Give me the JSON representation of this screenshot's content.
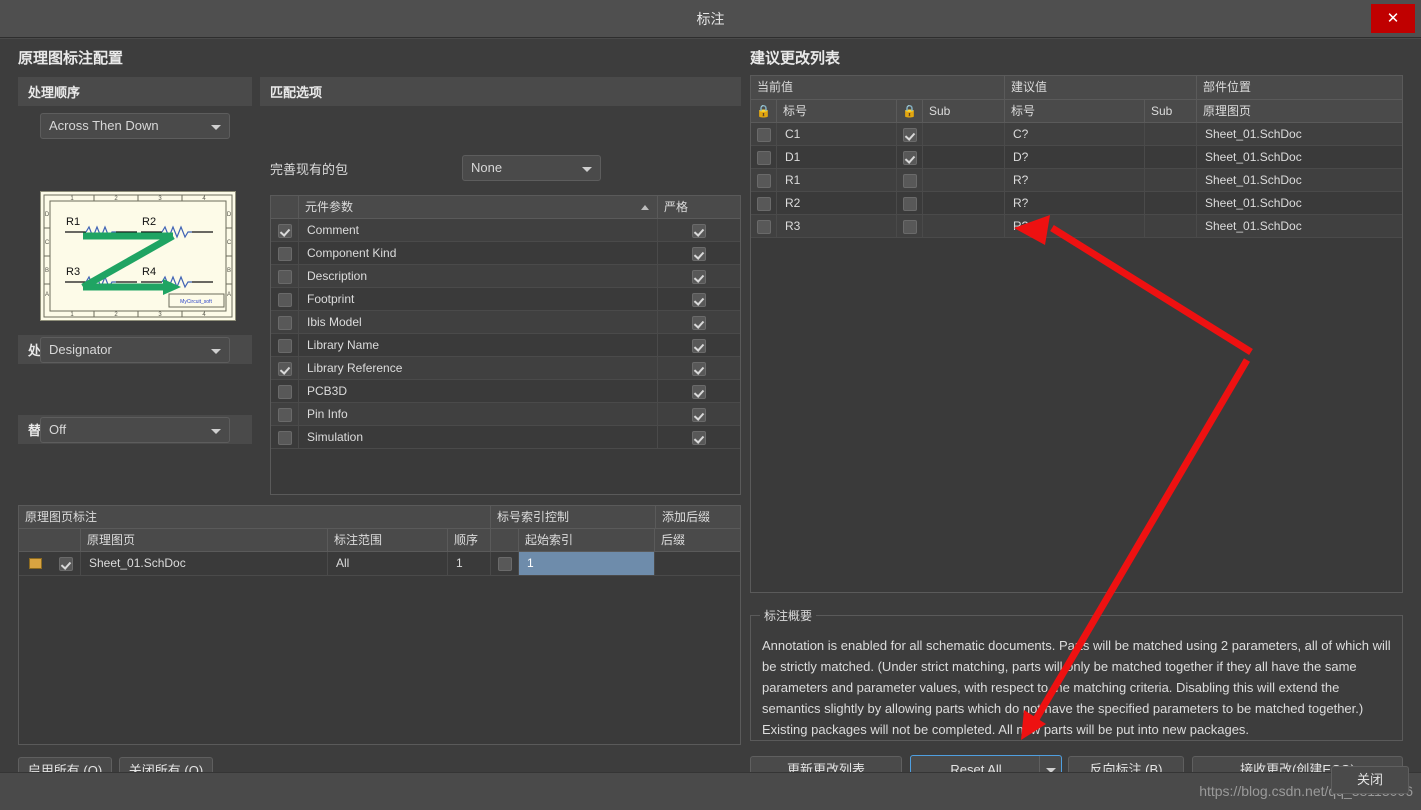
{
  "window": {
    "title": "标注",
    "close_icon": "close-icon"
  },
  "left": {
    "config_title": "原理图标注配置",
    "order_group": {
      "header": "处理顺序",
      "value": "Across Then Down"
    },
    "preview": {
      "designators": [
        "R1",
        "R2",
        "R3",
        "R4"
      ],
      "top_ticks": [
        "1",
        "2",
        "3",
        "4"
      ],
      "bottom_ticks": [
        "1",
        "2",
        "3",
        "4"
      ],
      "left_ticks": [
        "D",
        "C",
        "B",
        "A"
      ],
      "right_ticks": [
        "D",
        "C",
        "B",
        "A"
      ],
      "sheet_label": "MyCircuit_soft"
    },
    "location_group": {
      "header": "处理位置",
      "value": "Designator"
    },
    "subpart_group": {
      "header": "替换子部件",
      "value": "Off"
    },
    "match_group": {
      "header": "匹配选项",
      "refine_label": "完善现有的包",
      "refine_value": "None",
      "columns": [
        "元件参数",
        "严格"
      ],
      "sort_icon": "sort-asc-icon",
      "rows": [
        {
          "checked": true,
          "name": "Comment",
          "strict": true
        },
        {
          "checked": false,
          "name": "Component Kind",
          "strict": true
        },
        {
          "checked": false,
          "name": "Description",
          "strict": true
        },
        {
          "checked": false,
          "name": "Footprint",
          "strict": true
        },
        {
          "checked": false,
          "name": "Ibis Model",
          "strict": true
        },
        {
          "checked": false,
          "name": "Library Name",
          "strict": true
        },
        {
          "checked": true,
          "name": "Library Reference",
          "strict": true
        },
        {
          "checked": false,
          "name": "PCB3D",
          "strict": true
        },
        {
          "checked": false,
          "name": "Pin Info",
          "strict": true
        },
        {
          "checked": false,
          "name": "Simulation",
          "strict": true
        }
      ]
    },
    "sheet_grid": {
      "group_headers": [
        "原理图页标注",
        "标号索引控制",
        "添加后缀"
      ],
      "columns": [
        "原理图页",
        "标注范围",
        "顺序",
        "起始索引",
        "后缀"
      ],
      "rows": [
        {
          "doc_icon": "document-icon",
          "enabled": true,
          "sheet": "Sheet_01.SchDoc",
          "scope": "All",
          "order": "1",
          "index_lock": false,
          "start_index": "1",
          "suffix": ""
        }
      ]
    },
    "buttons": {
      "enable_all": "启用所有 (O)",
      "disable_all": "关闭所有 (O)"
    }
  },
  "right": {
    "changes_title": "建议更改列表",
    "group_headers": [
      "当前值",
      "建议值",
      "部件位置"
    ],
    "columns": {
      "cur_lock": "lock-icon",
      "cur_designator": "标号",
      "prop_lock": "lock-icon",
      "cur_sub": "Sub",
      "prop_designator": "标号",
      "prop_sub": "Sub",
      "location": "原理图页"
    },
    "rows": [
      {
        "sel": false,
        "current": "C1",
        "locked": true,
        "cur_sub": "",
        "proposed": "C?",
        "prop_sub": "",
        "location": "Sheet_01.SchDoc"
      },
      {
        "sel": false,
        "current": "D1",
        "locked": true,
        "cur_sub": "",
        "proposed": "D?",
        "prop_sub": "",
        "location": "Sheet_01.SchDoc"
      },
      {
        "sel": false,
        "current": "R1",
        "locked": false,
        "cur_sub": "",
        "proposed": "R?",
        "prop_sub": "",
        "location": "Sheet_01.SchDoc"
      },
      {
        "sel": false,
        "current": "R2",
        "locked": false,
        "cur_sub": "",
        "proposed": "R?",
        "prop_sub": "",
        "location": "Sheet_01.SchDoc"
      },
      {
        "sel": false,
        "current": "R3",
        "locked": false,
        "cur_sub": "",
        "proposed": "R?",
        "prop_sub": "",
        "location": "Sheet_01.SchDoc"
      }
    ],
    "summary": {
      "legend": "标注概要",
      "text": "Annotation is enabled for all schematic documents. Parts will be matched using 2 parameters, all of which will be strictly matched. (Under strict matching, parts will only be matched together if they all have the same parameters and parameter values, with respect to the matching criteria. Disabling this will extend the semantics slightly by allowing parts which do not have the specified parameters to be matched together.) Existing packages will not be completed. All new parts will be put into new packages."
    },
    "buttons": {
      "update": "更新更改列表",
      "reset_all": "Reset All",
      "reset_all_dropdown_icon": "chevron-down-icon",
      "back_annotate": "反向标注 (B)",
      "accept": "接收更改(创建ECO)"
    }
  },
  "bottom": {
    "watermark": "https://blog.csdn.net/qq_38113006",
    "close": "关闭"
  },
  "annotation_arrow": {
    "color": "#ee1111",
    "note": "red pointer annotation drawn over the dialog"
  },
  "colors": {
    "dialog_bg": "#3d3d3d",
    "header_bg": "#4a4a4a",
    "accent_close": "#c00000",
    "selection_blue": "#6e8cab",
    "focus_blue": "#4f9fe0",
    "schematic_green": "#1fa463",
    "text": "#dcdcdc"
  }
}
